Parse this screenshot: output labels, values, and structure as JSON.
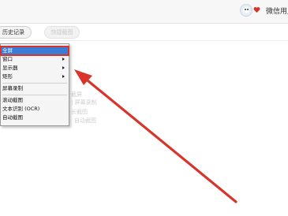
{
  "header": {
    "username": "微信用户"
  },
  "toolbar": {
    "history_label": "历史记录",
    "disabled_label": "快捷截图"
  },
  "background_fragments": [
    {
      "text": "截屏"
    },
    {
      "text": "| 屏幕录制"
    },
    {
      "text": "长截图"
    },
    {
      "text": "自动截图"
    }
  ],
  "menu": {
    "items": [
      {
        "label": "全屏",
        "selected": true
      },
      {
        "label": "窗口",
        "submenu": true
      },
      {
        "label": "显示器",
        "submenu": true
      },
      {
        "label": "矩形",
        "submenu": true
      },
      {
        "label": "屏幕录制"
      },
      {
        "label": "滚动截图"
      },
      {
        "label": "文本识别 (OCR)"
      },
      {
        "label": "自动截图"
      }
    ]
  },
  "colors": {
    "highlight": "#3a7dd6",
    "annotation": "#d9342b"
  }
}
